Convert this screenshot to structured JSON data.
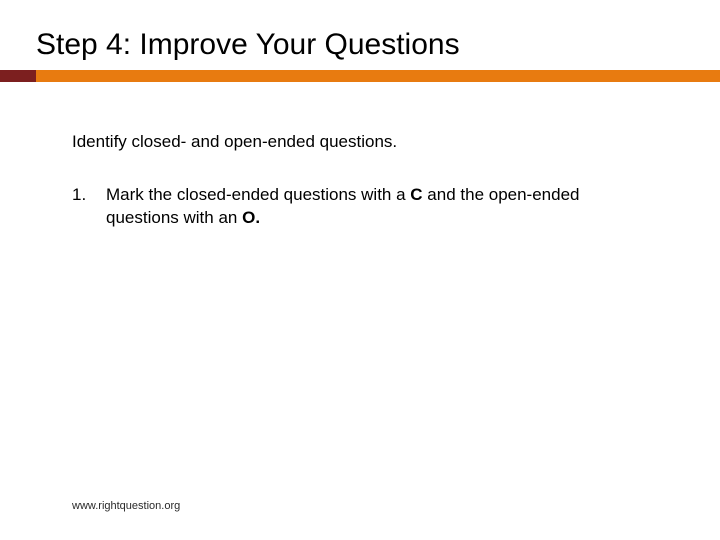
{
  "title": "Step 4: Improve Your Questions",
  "intro": "Identify closed- and open-ended questions.",
  "list": {
    "items": [
      {
        "num": "1.",
        "pre": "Mark the closed-ended questions with a ",
        "c": "C",
        "mid": " and the open-ended questions with an ",
        "o": "O.",
        "post": ""
      }
    ]
  },
  "footer": "www.rightquestion.org"
}
